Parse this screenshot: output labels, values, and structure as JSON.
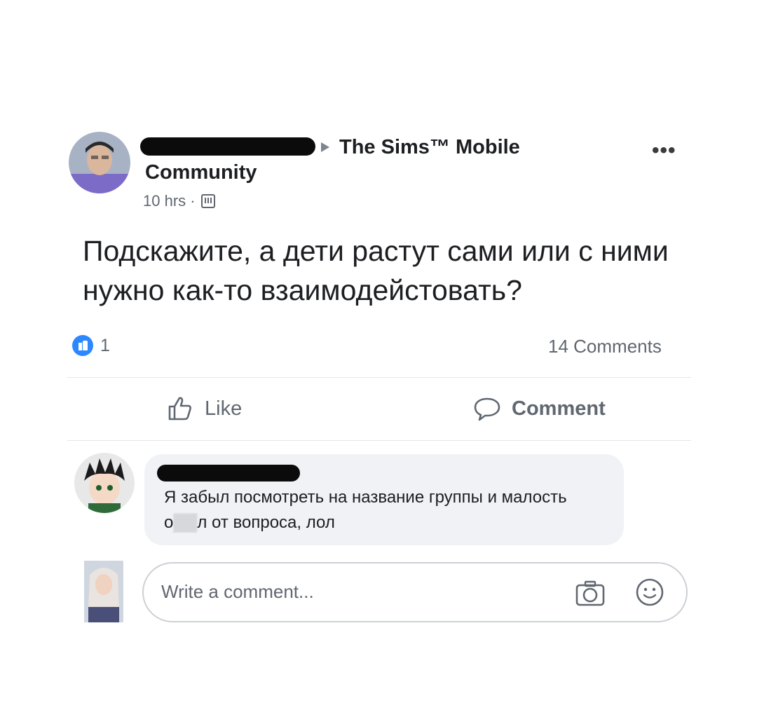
{
  "post": {
    "group_name": "The Sims™ Mobile",
    "community_label": "Community",
    "time": "10 hrs ·",
    "privacy_icon": "group-privacy-icon",
    "more_label": "•••",
    "text": "Подскажите, а дети растут сами или с ними нужно как-то взаимодейстовать?",
    "reaction_count": "1",
    "comment_count": "14 Comments",
    "colors": {
      "like_blue": "#2d88ff",
      "meta_gray": "#606770",
      "bubble": "#f0f2f5"
    }
  },
  "actions": {
    "like_label": "Like",
    "comment_label": "Comment"
  },
  "comment": {
    "text_part1": "Я забыл посмотреть на название группы и малость о",
    "text_obscured": "▒▒",
    "text_part2": "л от вопроса, лол"
  },
  "compose": {
    "placeholder": "Write a comment..."
  }
}
